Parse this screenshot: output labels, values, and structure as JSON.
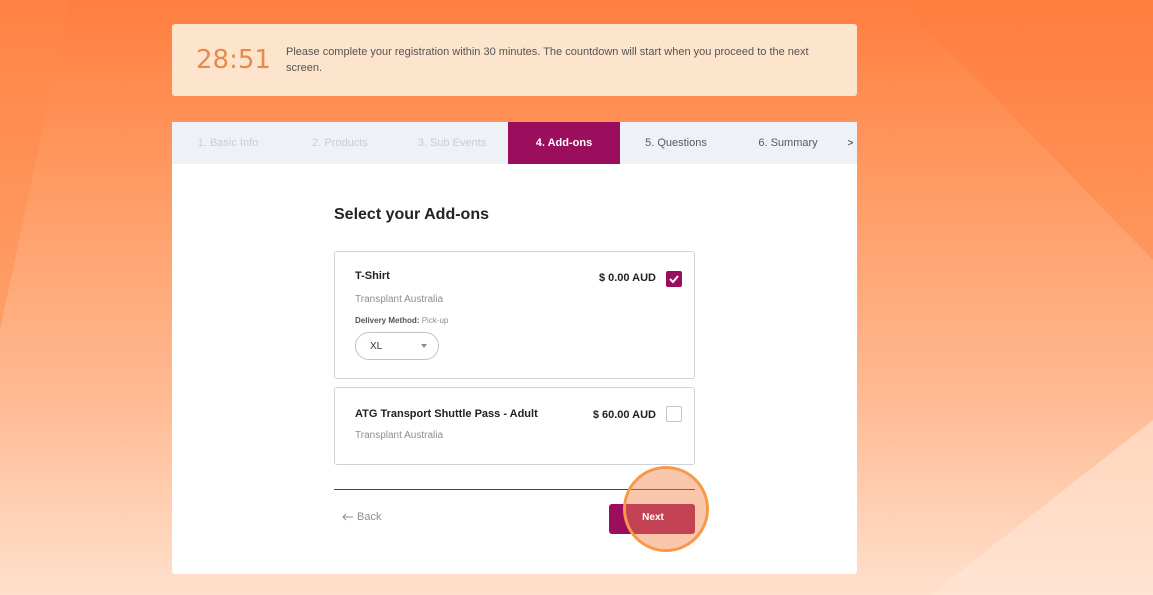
{
  "colors": {
    "accent": "#9b0d5d",
    "banner_bg": "#fde4cd",
    "timer": "#e88a4a",
    "highlight": "#f59a4a"
  },
  "timer": {
    "value": "28:51",
    "message": "Please complete your registration within 30 minutes. The countdown will start when you proceed to the next screen."
  },
  "tabs": [
    {
      "label": "1. Basic Info",
      "state": "done"
    },
    {
      "label": "2. Products",
      "state": "done"
    },
    {
      "label": "3. Sub Events",
      "state": "done"
    },
    {
      "label": "4. Add-ons",
      "state": "active"
    },
    {
      "label": "5. Questions",
      "state": "upcoming"
    },
    {
      "label": "6. Summary",
      "state": "upcoming"
    }
  ],
  "tabs_more": ">",
  "main": {
    "title": "Select your Add-ons",
    "addons": [
      {
        "name": "T-Shirt",
        "org": "Transplant Australia",
        "price": "$ 0.00 AUD",
        "checked": true,
        "delivery_label": "Delivery Method:",
        "delivery_value": "Pick-up",
        "size_value": "XL"
      },
      {
        "name": "ATG Transport Shuttle Pass - Adult",
        "org": "Transplant Australia",
        "price": "$ 60.00 AUD",
        "checked": false
      }
    ],
    "back_label": "Back",
    "next_label": "Next"
  },
  "icons": {
    "checkmark": "check-icon",
    "select_chevron": "chevron-down-icon",
    "back_arrow": "arrow-left-icon"
  }
}
